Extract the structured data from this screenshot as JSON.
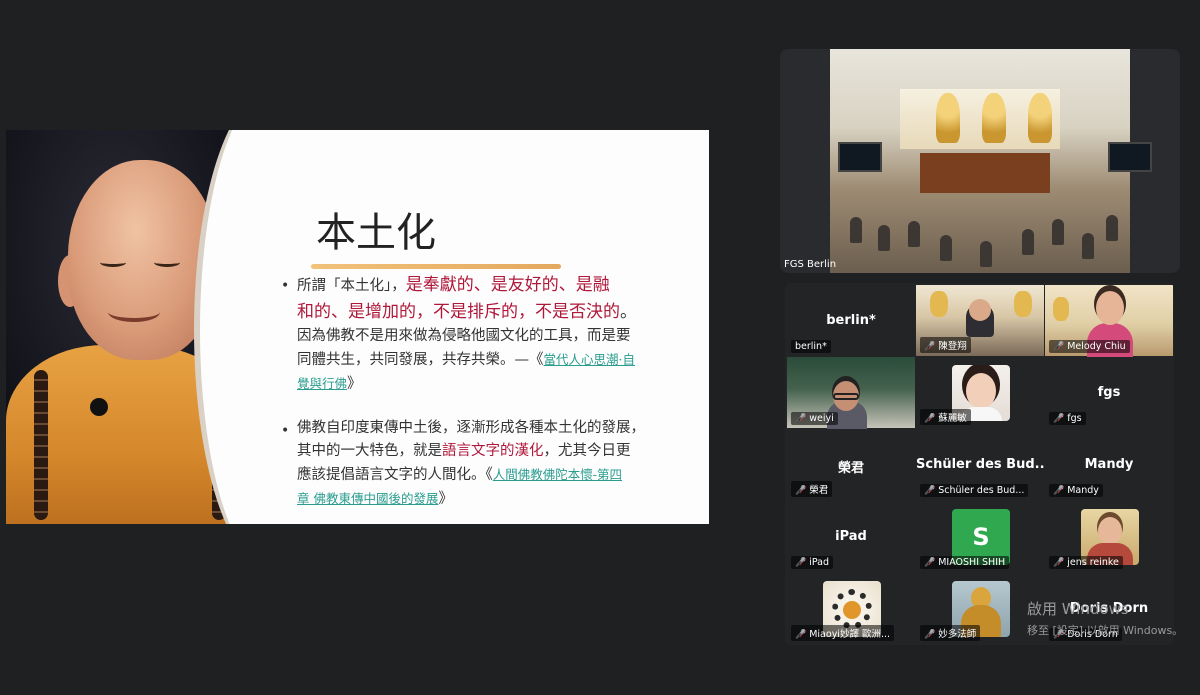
{
  "slide": {
    "title": "本土化",
    "bullet1": {
      "line1_plain": "所謂「本土化」，",
      "line1_red": "是奉獻的、是友好的、是融",
      "line2_red": "和的、是增加的，不是排斥的，不是否決的",
      "line2_end": "。",
      "line3": "因為佛教不是用來做為侵略他國文化的工具，而是要",
      "line4_plain": "同體共生，共同發展，共存共榮。—《",
      "line4_link": "當代人心思潮·自",
      "line5_link": "覺與行佛",
      "line5_end": "》"
    },
    "bullet2": {
      "line1": "佛教自印度東傳中土後，逐漸形成各種本土化的發展，",
      "line2_plain": "其中的一大特色，就是",
      "line2_red": "語言文字的漢化",
      "line2_end": "，尤其今日更",
      "line3_plain": "應該提倡語言文字的人間化。《",
      "line3_link": "人間佛教佛陀本懷-第四",
      "line4_link": "章 佛教東傳中國後的發展",
      "line4_end": "》"
    }
  },
  "feed": {
    "label": "FGS Berlin"
  },
  "participants": [
    {
      "name": "berlin*",
      "label": "berlin*",
      "muted": false,
      "kind": "name"
    },
    {
      "name": "",
      "label": "陳登翔",
      "muted": true,
      "kind": "video-hall"
    },
    {
      "name": "",
      "label": "Melody Chiu",
      "muted": true,
      "kind": "video-woman"
    },
    {
      "name": "",
      "label": "weiyi",
      "muted": true,
      "kind": "video-man"
    },
    {
      "name": "",
      "label": "蘇麗敏",
      "muted": true,
      "kind": "thumb-woman"
    },
    {
      "name": "fgs",
      "label": "fgs",
      "muted": true,
      "kind": "name"
    },
    {
      "name": "榮君",
      "label": "榮君",
      "muted": true,
      "kind": "name"
    },
    {
      "name": "Schüler des Bud...",
      "label": "Schüler des Bud...",
      "muted": true,
      "kind": "name"
    },
    {
      "name": "Mandy",
      "label": "Mandy",
      "muted": true,
      "kind": "name"
    },
    {
      "name": "iPad",
      "label": "iPad",
      "muted": true,
      "kind": "name"
    },
    {
      "name": "S",
      "label": "MIAOSHI SHIH",
      "muted": true,
      "kind": "avatar"
    },
    {
      "name": "",
      "label": "jens reinke",
      "muted": true,
      "kind": "thumb-man"
    },
    {
      "name": "",
      "label": "Miaoyi妙譯 歐洲...",
      "muted": true,
      "kind": "thumb-beads"
    },
    {
      "name": "",
      "label": "妙多法師",
      "muted": true,
      "kind": "thumb-buddha"
    },
    {
      "name": "Doris Dorn",
      "label": "Doris Dorn",
      "muted": true,
      "kind": "name"
    }
  ],
  "watermark": {
    "line1": "啟用 Windows",
    "line2": "移至 [設定] 以啟用 Windows。"
  }
}
